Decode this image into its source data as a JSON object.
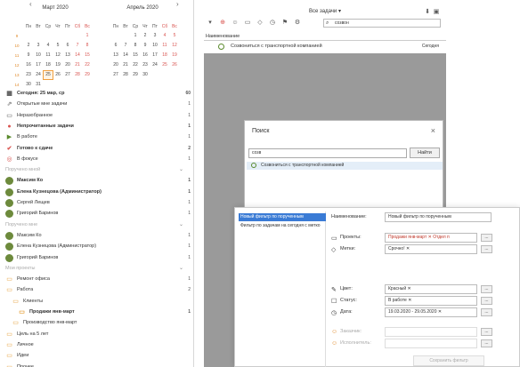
{
  "calendar": {
    "months": [
      {
        "title": "Март 2020"
      },
      {
        "title": "Апрель 2020"
      }
    ],
    "weekdays": [
      "Пн",
      "Вт",
      "Ср",
      "Чт",
      "Пт",
      "Сб",
      "Вс"
    ],
    "march_weeks": [
      [
        "",
        "",
        "",
        "",
        "",
        "1"
      ],
      [
        "2",
        "3",
        "4",
        "5",
        "6",
        "7",
        "8"
      ],
      [
        "9",
        "10",
        "11",
        "12",
        "13",
        "14",
        "15"
      ],
      [
        "16",
        "17",
        "18",
        "19",
        "20",
        "21",
        "22"
      ],
      [
        "23",
        "24",
        "25",
        "26",
        "27",
        "28",
        "29"
      ],
      [
        "30",
        "31",
        "",
        "",
        "",
        "",
        ""
      ]
    ],
    "april_weeks": [
      [
        "",
        "",
        "1",
        "2",
        "3",
        "4",
        "5"
      ],
      [
        "6",
        "7",
        "8",
        "9",
        "10",
        "11",
        "12"
      ],
      [
        "13",
        "14",
        "15",
        "16",
        "17",
        "18",
        "19"
      ],
      [
        "20",
        "21",
        "22",
        "23",
        "24",
        "25",
        "26"
      ],
      [
        "27",
        "28",
        "29",
        "30",
        "",
        "",
        ""
      ]
    ],
    "week_numbers": [
      "9",
      "10",
      "11",
      "12",
      "13",
      "14"
    ],
    "today": "25"
  },
  "sidebar": {
    "items": [
      {
        "label": "Сегодня: 25 мар, ср",
        "count": "60",
        "bold": true,
        "icon": "calendar-icon"
      },
      {
        "label": "Открытые мне задачи",
        "count": "1",
        "bold": false,
        "icon": "share-icon"
      },
      {
        "label": "Неразобранное",
        "count": "1",
        "bold": false,
        "icon": "inbox-icon"
      },
      {
        "label": "Непрочитанные задачи",
        "count": "1",
        "bold": true,
        "icon": "unread-icon"
      },
      {
        "label": "В работе",
        "count": "1",
        "bold": false,
        "icon": "play-icon"
      },
      {
        "label": "Готово к сдаче",
        "count": "2",
        "bold": true,
        "icon": "check-icon"
      },
      {
        "label": "В фокусе",
        "count": "1",
        "bold": false,
        "icon": "focus-icon"
      }
    ],
    "section_assigned": "Поручено мной",
    "people_assigned": [
      {
        "name": "Максим Ко",
        "count": "1",
        "bold": true
      },
      {
        "name": "Елена Кузнецова (Администратор)",
        "count": "1",
        "bold": true
      },
      {
        "name": "Сергей Лещев",
        "count": "1",
        "bold": false
      },
      {
        "name": "Григорий Баринов",
        "count": "1",
        "bold": false
      }
    ],
    "section_received": "Поручено мне",
    "people_received": [
      {
        "name": "Максим Ко",
        "count": "1"
      },
      {
        "name": "Елена Кузнецова (Администратор)",
        "count": "1"
      },
      {
        "name": "Григорий Баринов",
        "count": "1"
      }
    ],
    "section_projects": "Мои проекты",
    "projects": [
      {
        "label": "Ремонт офиса",
        "count": "1",
        "bold": false,
        "indent": 1
      },
      {
        "label": "Работа",
        "count": "2",
        "bold": false,
        "indent": 1
      },
      {
        "label": "Клиенты",
        "count": "",
        "bold": false,
        "indent": 2
      },
      {
        "label": "Продажи янв-март",
        "count": "1",
        "bold": true,
        "indent": 3
      },
      {
        "label": "Производство янв-март",
        "count": "",
        "bold": false,
        "indent": 2
      },
      {
        "label": "Цель на 5 лет",
        "count": "",
        "bold": false,
        "indent": 1
      },
      {
        "label": "Личное",
        "count": "",
        "bold": false,
        "indent": 1
      },
      {
        "label": "Идеи",
        "count": "",
        "bold": false,
        "indent": 1
      },
      {
        "label": "Прочее",
        "count": "",
        "bold": false,
        "indent": 1
      },
      {
        "label": "Архив",
        "count": "1",
        "bold": false,
        "indent": 1
      }
    ]
  },
  "main": {
    "view_title": "Все задачи ▾",
    "search_value": "созвон",
    "column_header": "Наименование",
    "task": {
      "title": "Созвониться с транспортной компанией",
      "due": "Сегодня"
    }
  },
  "search_dialog": {
    "title": "Поиск",
    "query": "созв",
    "button": "Найти",
    "result": "Созвониться с транспортной компанией"
  },
  "filter_dialog": {
    "list": [
      "Новый фильтр по порученным",
      "Фильтр по задачам на сегодня с метко"
    ],
    "name_label": "Наименование:",
    "name_value": "Новый фильтр по порученным",
    "projects_label": "Проекты:",
    "projects_value": "Продажи янв-март ✕   Отдел п",
    "tags_label": "Метки:",
    "tags_value": "Срочно! ✕",
    "color_label": "Цвет:",
    "color_value": "Красный ✕",
    "status_label": "Статус:",
    "status_value": "В работе ✕",
    "date_label": "Дата:",
    "date_value": "19.03.2020 - 29.05.2020 ✕",
    "customer_label": "Заказчик:",
    "executor_label": "Исполнитель:",
    "save_button": "Сохранить фильтр",
    "browse": "..."
  }
}
